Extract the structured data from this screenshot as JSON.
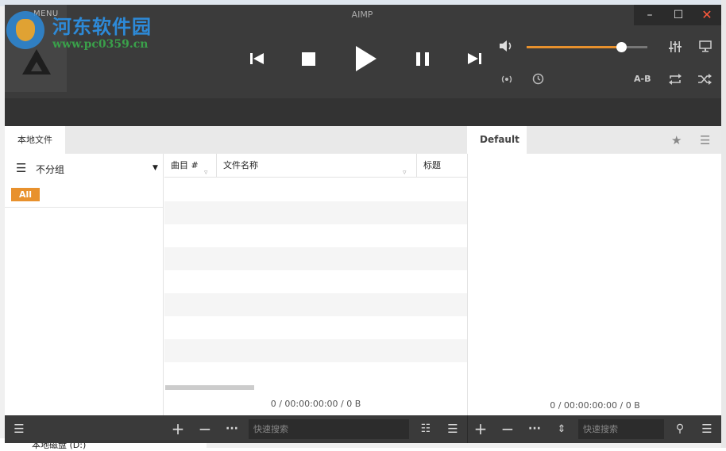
{
  "window": {
    "title": "AIMP",
    "menu_label": "MENU",
    "minimize_icon": "–",
    "maximize_icon": "☐",
    "close_icon": "✕"
  },
  "player": {
    "volume_level_percent": 78,
    "ab_repeat_label": "A-B",
    "accent_color": "#e8912d"
  },
  "tabs": {
    "library_tab": "本地文件",
    "playlist_tab": "Default"
  },
  "library": {
    "grouping_label": "不分组",
    "filter_badge": "All",
    "columns": [
      {
        "label": "曲目 #"
      },
      {
        "label": "文件名称"
      },
      {
        "label": "标题"
      }
    ],
    "status": "0 / 00:00:00:00 / 0 B"
  },
  "playlist": {
    "status": "0 / 00:00:00:00 / 0 B"
  },
  "bottombar": {
    "library_search_placeholder": "快速搜索",
    "playlist_search_placeholder": "快速搜索"
  },
  "watermark": {
    "title": "河东软件园",
    "url": "www.pc0359.cn"
  },
  "desktop": {
    "bottom_text": "本地磁盘 (D:)"
  }
}
